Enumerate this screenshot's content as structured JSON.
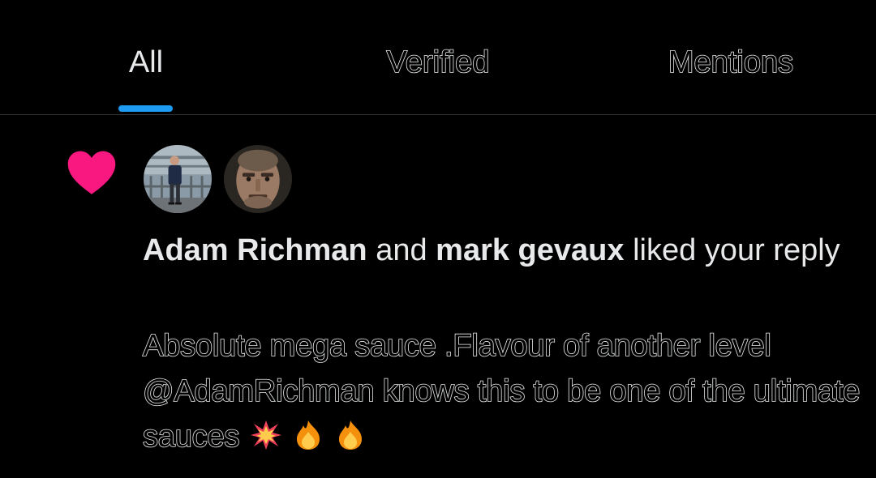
{
  "tabs": [
    {
      "label": "All",
      "active": true
    },
    {
      "label": "Verified",
      "active": false
    },
    {
      "label": "Mentions",
      "active": false
    }
  ],
  "colors": {
    "background": "#000000",
    "text": "#e7e9ea",
    "accent": "#1d9bf0",
    "like": "#f91880",
    "divider": "#2f3336"
  },
  "notification": {
    "type": "like",
    "icon": "heart-icon",
    "avatars": [
      {
        "user": "Adam Richman",
        "icon": "avatar-photo"
      },
      {
        "user": "mark gevaux",
        "icon": "avatar-photo"
      }
    ],
    "user1": "Adam Richman",
    "conjunction": "and",
    "user2": "mark gevaux",
    "action": "liked your reply",
    "reply_text": "Absolute mega sauce .Flavour of another level @AdamRichman knows this to be one of the ultimate sauces",
    "emojis": [
      "collision-emoji",
      "fire-emoji",
      "fire-emoji"
    ]
  }
}
